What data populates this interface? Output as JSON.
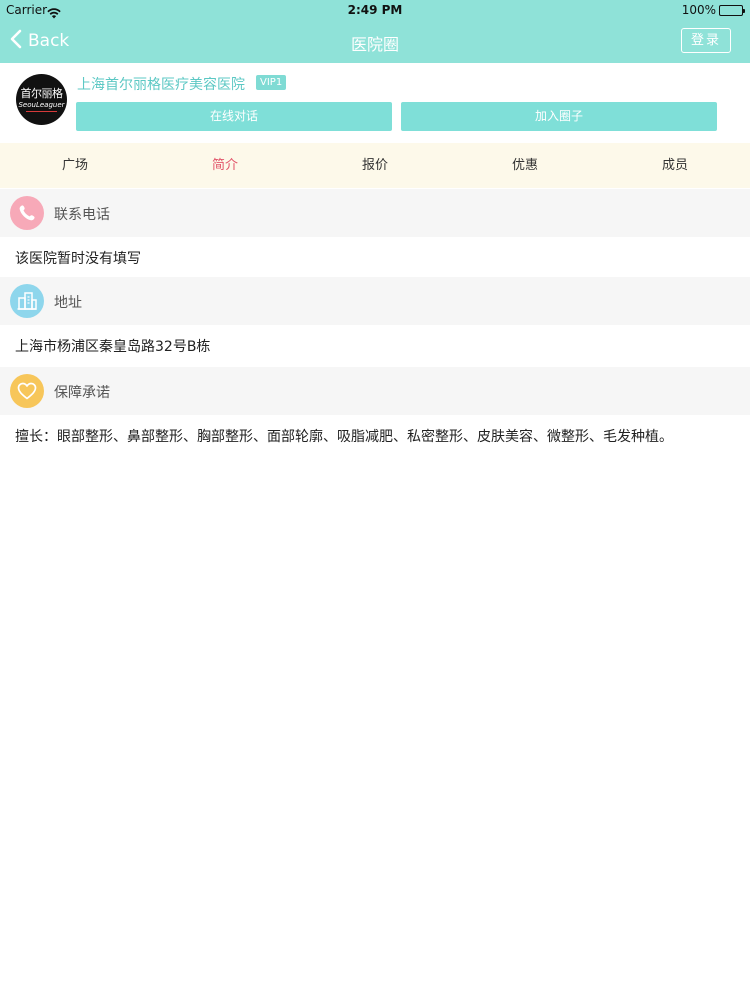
{
  "status_bar": {
    "carrier": "Carrier",
    "time": "2:49 PM",
    "battery_text": "100%",
    "battery_level": 1.0
  },
  "nav": {
    "back_label": "Back",
    "title": "医院圈",
    "login_label": "登录"
  },
  "hospital": {
    "logo_cn": "首尔丽格",
    "logo_en": "SeouLeaguer",
    "name": "上海首尔丽格医疗美容医院",
    "vip_badge": "VIP1",
    "chat_button": "在线对话",
    "join_button": "加入圈子"
  },
  "tabs": [
    {
      "label": "广场",
      "active": false
    },
    {
      "label": "简介",
      "active": true
    },
    {
      "label": "报价",
      "active": false
    },
    {
      "label": "优惠",
      "active": false
    },
    {
      "label": "成员",
      "active": false
    }
  ],
  "sections": {
    "phone": {
      "icon": "phone-icon",
      "color": "#f7a9b8",
      "title": "联系电话",
      "content": "该医院暂时没有填写"
    },
    "address": {
      "icon": "building-icon",
      "color": "#8ed6ec",
      "title": "地址",
      "content": "上海市杨浦区秦皇岛路32号B栋"
    },
    "guarantee": {
      "icon": "heart-icon",
      "color": "#f7c65a",
      "title": "保障承诺",
      "content": "擅长：眼部整形、鼻部整形、胸部整形、面部轮廓、吸脂减肥、私密整形、皮肤美容、微整形、毛发种植。"
    }
  },
  "colors": {
    "nav_bg": "#8fe2d8",
    "accent": "#7fdfd8",
    "tab_active": "#e2566b",
    "tab_bg": "#fdf9ea"
  }
}
